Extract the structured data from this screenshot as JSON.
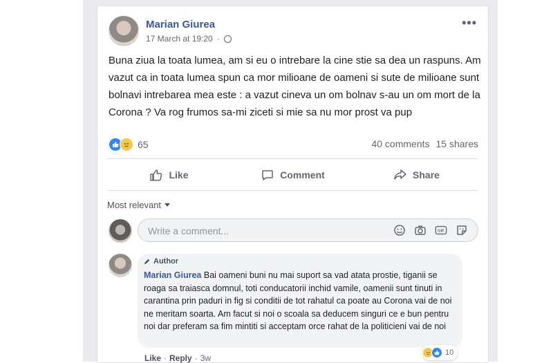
{
  "post": {
    "author": "Marian Giurea",
    "timestamp": "17 March at 19:20",
    "privacy_icon": "globe-icon",
    "more_label": "•••",
    "text": "Buna ziua la toata lumea, am si eu o intrebare la cine stie sa dea un raspuns. Am vazut ca in toata lumea spun ca mor milioane de oameni si sute de milioane sunt bolnavi intrebarea mea este : a vazut cineva un om bolnav s-au un om mort de la Corona ? Va rog frumos sa-mi ziceti si mie sa nu mor prost va pup",
    "reactions_count": "65",
    "comments_count": "40 comments",
    "shares_count": "15 shares"
  },
  "actions": {
    "like": "Like",
    "comment": "Comment",
    "share": "Share"
  },
  "comments": {
    "sort_label": "Most relevant",
    "placeholder": "Write a comment...",
    "items": [
      {
        "badge": "Author",
        "name": "Marian Giurea",
        "text": "Bai oameni buni nu mai suport sa vad atata prostie, tiganii se roaga sa traiasca domnul, toti conducatorii inchid vamile, oamenii sunt tinuti in carantina prin paduri in fig si conditii de tot rahatul ca poate au Corona vai de noi ne meritam soarta. Am facut si noi o scoala sa deducem singuri ce e bun pentru noi dar preferam sa fim mintiti si acceptam orce rahat de la politicieni vai de noi",
        "reactions_count": "10",
        "like_label": "Like",
        "reply_label": "Reply",
        "age": "3w"
      }
    ]
  },
  "colors": {
    "link_blue": "#385898",
    "like_blue": "#2d88ff",
    "sad_yellow": "#f7c94a",
    "muted": "#606770"
  }
}
